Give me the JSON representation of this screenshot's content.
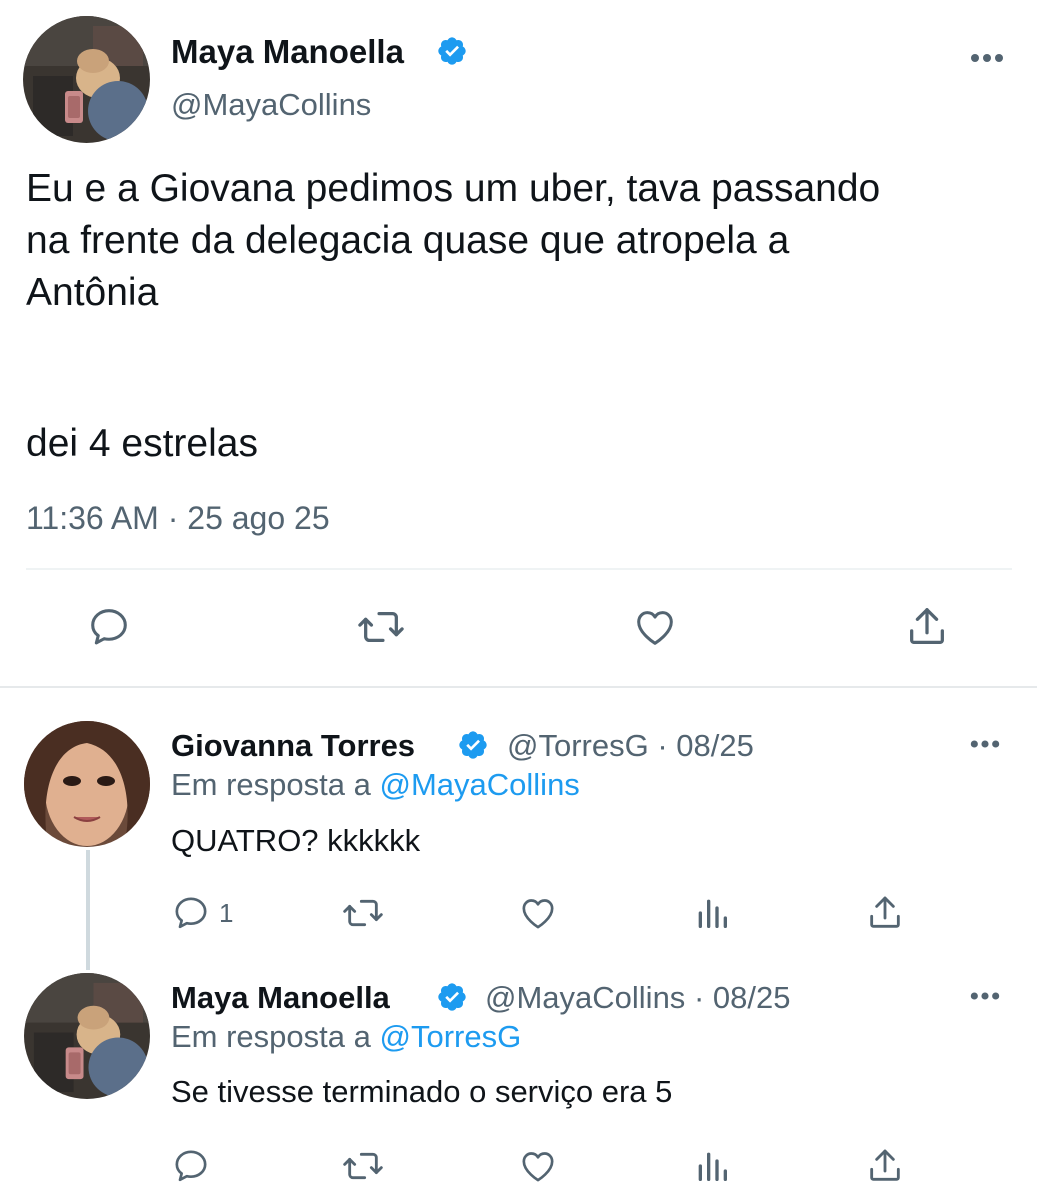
{
  "colors": {
    "accent": "#1d9bf0",
    "text": "#0f1419",
    "secondary": "#536471",
    "divider": "#eff3f4"
  },
  "main_tweet": {
    "author_name": "Maya Manoella",
    "author_handle": "@MayaCollins",
    "verified_icon": "verified-badge-icon",
    "text_line1": "Eu e a Giovana pedimos um uber, tava passando",
    "text_line2": "na frente da delegacia quase que atropela a",
    "text_line3": "Antônia",
    "text_paragraph2": "dei 4 estrelas",
    "timestamp": "11:36 AM · 25 ago 25",
    "actions": [
      "reply-icon",
      "retweet-icon",
      "like-icon",
      "share-icon"
    ]
  },
  "replies": [
    {
      "author_name": "Giovanna Torres",
      "author_handle": "@TorresG",
      "date": "· 08/25",
      "reply_prefix": "Em resposta a",
      "reply_mention": "@MayaCollins",
      "text": "QUATRO? kkkkkk",
      "reply_count": "1",
      "actions": [
        "reply-icon",
        "retweet-icon",
        "like-icon",
        "analytics-icon",
        "share-icon"
      ]
    },
    {
      "author_name": "Maya Manoella",
      "author_handle": "@MayaCollins",
      "date": "· 08/25",
      "reply_prefix": "Em resposta a",
      "reply_mention": "@TorresG",
      "text": "Se tivesse terminado o serviço era 5",
      "actions": [
        "reply-icon",
        "retweet-icon",
        "like-icon",
        "analytics-icon",
        "share-icon"
      ]
    }
  ]
}
